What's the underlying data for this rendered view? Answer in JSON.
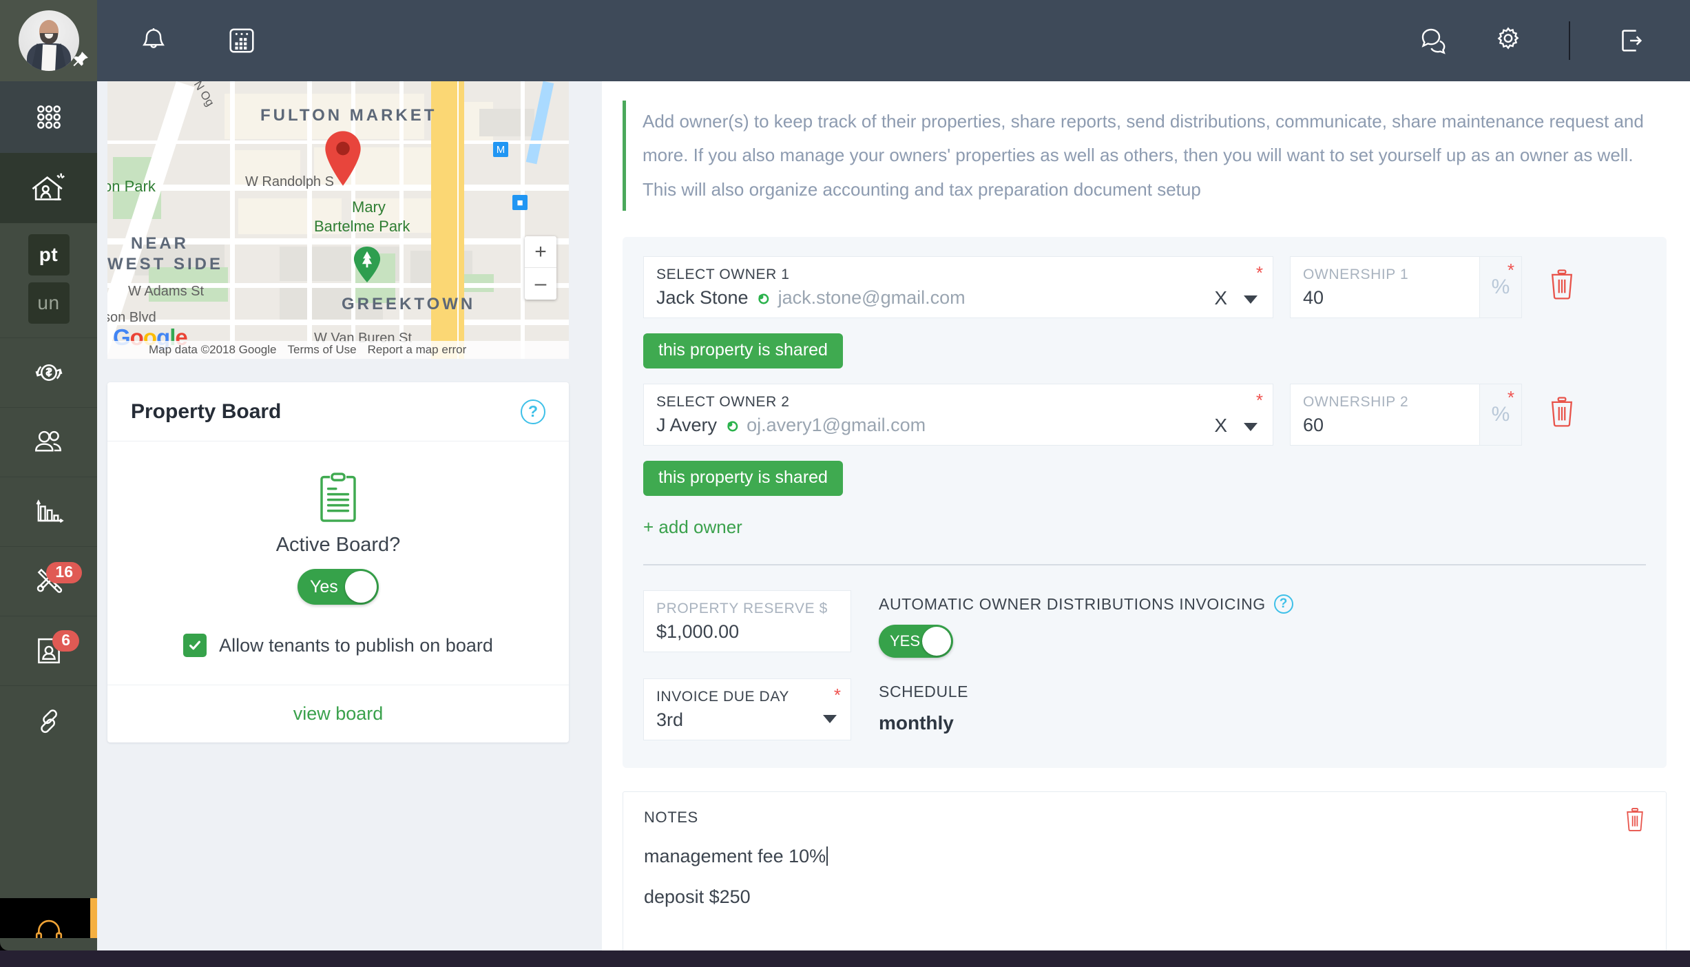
{
  "topbar": {
    "icons_left": [
      {
        "name": "notifications-icon",
        "label": "Notifications"
      },
      {
        "name": "calendar-icon",
        "label": "Calendar"
      }
    ],
    "icons_right": [
      {
        "name": "chat-icon",
        "label": "Messages"
      },
      {
        "name": "gear-icon",
        "label": "Settings"
      },
      {
        "name": "logout-icon",
        "label": "Log out"
      }
    ],
    "avatar_name": "user-avatar",
    "pin_icon": "pin-icon"
  },
  "rail": {
    "items": [
      {
        "name": "apps-grid-icon",
        "label": "Apps"
      },
      {
        "name": "property-icon",
        "label": "Properties"
      },
      {
        "name": "transactions-icon",
        "label": "Transactions"
      },
      {
        "name": "people-icon",
        "label": "Contacts"
      },
      {
        "name": "reports-icon",
        "label": "Reports"
      },
      {
        "name": "maintenance-icon",
        "label": "Maintenance"
      },
      {
        "name": "applicants-icon",
        "label": "Applicants"
      },
      {
        "name": "links-icon",
        "label": "Links"
      }
    ],
    "tags": [
      {
        "name": "tag-pt",
        "label": "pt"
      },
      {
        "name": "tag-un",
        "label": "un"
      }
    ],
    "badges": {
      "maintenance": "16",
      "applicants": "6"
    },
    "support_label": "Support"
  },
  "map": {
    "labels": [
      {
        "text": "FULTON MARKET",
        "type": "neighborhood"
      },
      {
        "text": "NEAR",
        "type": "neighborhood"
      },
      {
        "text": "WEST SIDE",
        "type": "neighborhood"
      },
      {
        "text": "GREEKTOWN",
        "type": "neighborhood"
      },
      {
        "text": "Mary",
        "type": "park"
      },
      {
        "text": "Bartelme Park",
        "type": "park"
      },
      {
        "text": "on Park",
        "type": "park"
      },
      {
        "text": "W Randolph S",
        "type": "street"
      },
      {
        "text": "W Adams St",
        "type": "street"
      },
      {
        "text": "son Blvd",
        "type": "street"
      },
      {
        "text": "W Van Buren St",
        "type": "street"
      },
      {
        "text": "N Og",
        "type": "street"
      }
    ],
    "zoom_in": "+",
    "zoom_out": "–",
    "attribution": "Map data ©2018 Google",
    "terms": "Terms of Use",
    "report": "Report a map error",
    "logo": "Google"
  },
  "property_board": {
    "title": "Property Board",
    "help": "?",
    "icon": "clipboard-icon",
    "active_label": "Active Board?",
    "active_toggle": "Yes",
    "checkbox_label": "Allow tenants to publish on board",
    "checkbox_checked": true,
    "view_board": "view board"
  },
  "notice": {
    "text": "Add owner(s) to keep track of their properties, share reports, send distributions, communicate, share maintenance request and more. If you also manage your owners' properties as well as others, then you will want to set yourself up as an owner as well. This will also organize accounting and tax preparation document setup"
  },
  "owners": [
    {
      "select_label": "SELECT OWNER 1",
      "name": "Jack Stone",
      "email": "jack.stone@gmail.com",
      "clear": "X",
      "ownership_label": "OWNERSHIP 1",
      "ownership_value": "40",
      "percent_symbol": "%",
      "required": "*",
      "shared_pill": "this property is shared",
      "delete": "trash-icon"
    },
    {
      "select_label": "SELECT OWNER 2",
      "name": "J Avery",
      "email": "oj.avery1@gmail.com",
      "clear": "X",
      "ownership_label": "OWNERSHIP 2",
      "ownership_value": "60",
      "percent_symbol": "%",
      "required": "*",
      "shared_pill": "this property is shared",
      "delete": "trash-icon"
    }
  ],
  "add_owner": "+ add owner",
  "reserve": {
    "label": "PROPERTY RESERVE $",
    "value": "$1,000.00"
  },
  "distributions": {
    "label": "AUTOMATIC OWNER DISTRIBUTIONS INVOICING",
    "help": "?",
    "toggle": "YES"
  },
  "invoice_due": {
    "label": "INVOICE DUE DAY",
    "value": "3rd",
    "required": "*"
  },
  "schedule": {
    "label": "SCHEDULE",
    "value": "monthly"
  },
  "notes": {
    "label": "NOTES",
    "line1": "management fee 10%",
    "line2": "deposit $250",
    "delete": "trash-icon"
  },
  "colors": {
    "green": "#3faa50",
    "red": "#ef5350",
    "blue": "#3ec0e8",
    "rail": "#424b41",
    "topbar": "#3e4a59",
    "accent_orange": "#f5b041"
  }
}
